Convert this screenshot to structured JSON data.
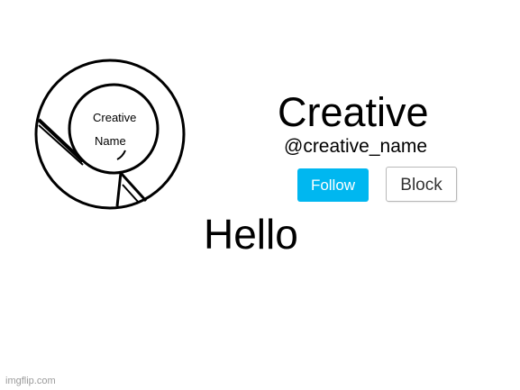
{
  "profile": {
    "avatar_text_line1": "Creative",
    "avatar_text_line2": "Name",
    "display_name": "Creative",
    "handle": "@creative_name"
  },
  "actions": {
    "follow_label": "Follow",
    "block_label": "Block"
  },
  "post": {
    "message": "Hello"
  },
  "footer": {
    "watermark": "imgflip.com"
  },
  "colors": {
    "background": "#ffffff",
    "follow_button": "#00b7f0",
    "follow_text": "#ffffff",
    "block_border": "#b8b8b8",
    "text": "#000000",
    "watermark": "#9a9a9a"
  }
}
